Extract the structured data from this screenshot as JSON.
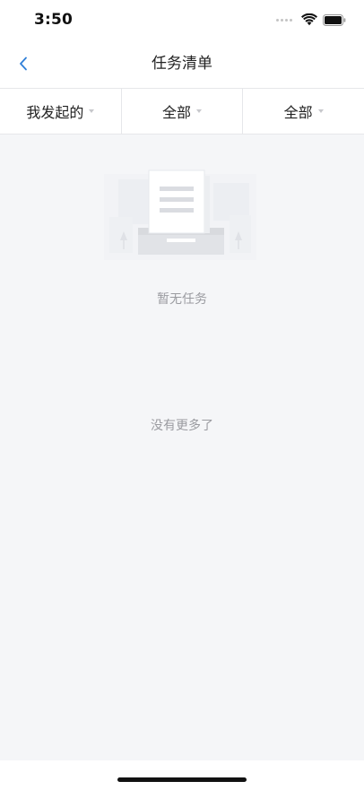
{
  "status_bar": {
    "time": "3:50"
  },
  "header": {
    "title": "任务清单"
  },
  "filters": [
    {
      "label": "我发起的"
    },
    {
      "label": "全部"
    },
    {
      "label": "全部"
    }
  ],
  "empty_state": {
    "message": "暂无任务",
    "illustration": "empty-document-illustration"
  },
  "list_footer": {
    "text": "没有更多了"
  },
  "icons": {
    "back": "chevron-left-icon",
    "caret": "caret-down-icon",
    "wifi": "wifi-icon",
    "battery": "battery-icon"
  },
  "colors": {
    "accent": "#2f7fd8",
    "background": "#f5f6f8",
    "muted_text": "#9a9ba0"
  }
}
